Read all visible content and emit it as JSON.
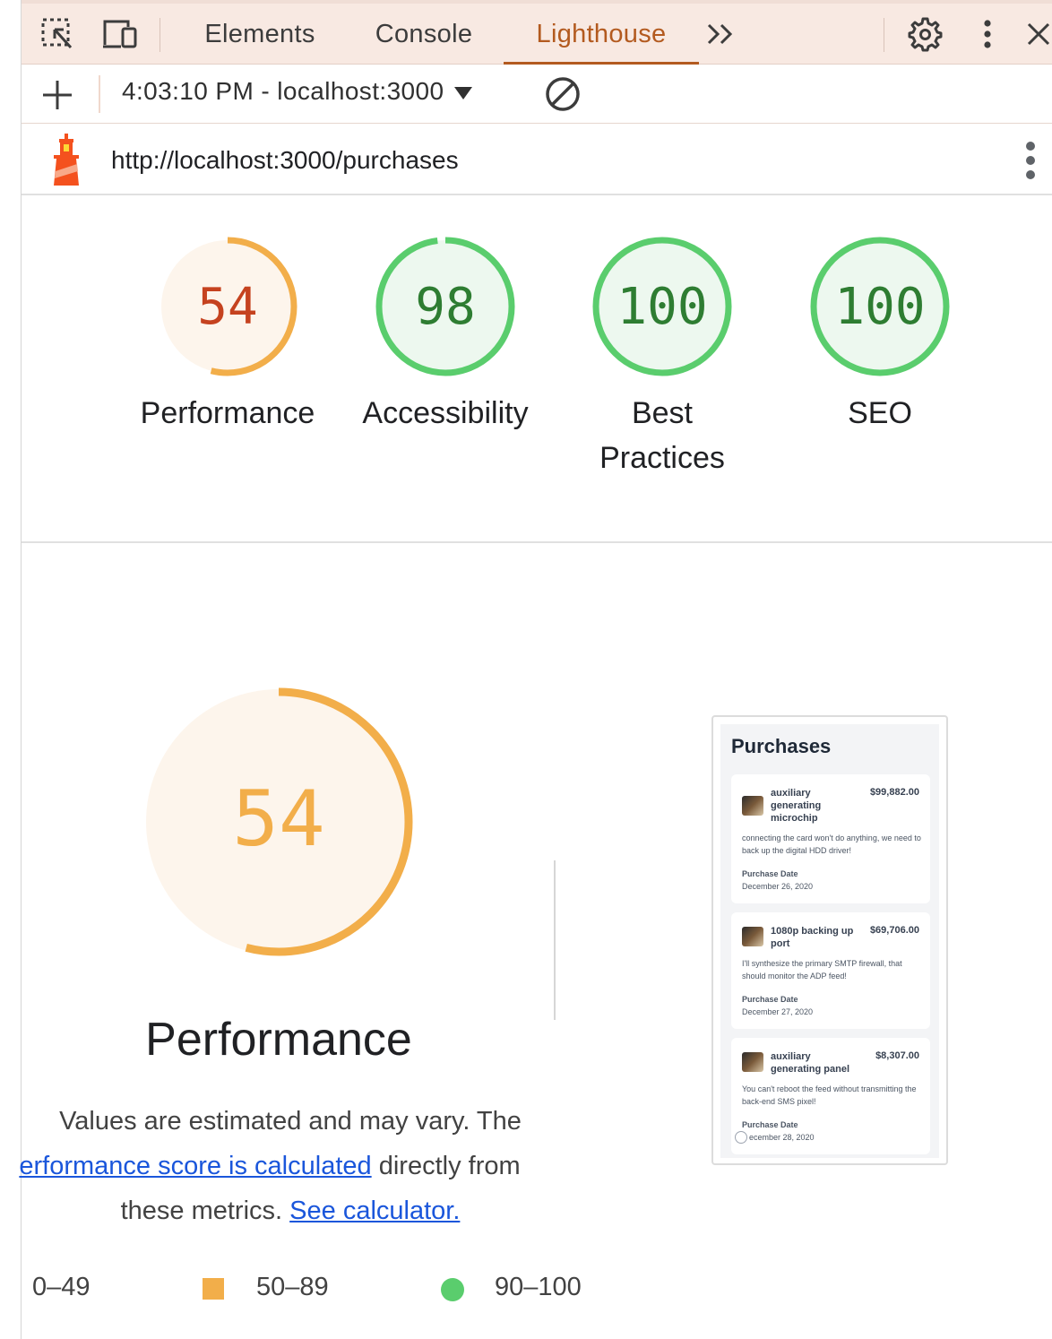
{
  "toolbar": {
    "tabs": [
      {
        "label": "Elements",
        "active": false
      },
      {
        "label": "Console",
        "active": false
      },
      {
        "label": "Lighthouse",
        "active": true
      }
    ],
    "more_tabs_icon": "double-chevron-right-icon",
    "settings_icon": "gear-icon",
    "menu_icon": "kebab-icon",
    "close_icon": "close-icon",
    "inspect_icon": "inspect-element-icon",
    "device_icon": "device-toolbar-icon"
  },
  "runbar": {
    "report_selector": "4:03:10 PM - localhost:3000",
    "new_report_icon": "plus-icon",
    "clear_icon": "block-icon"
  },
  "urlbar": {
    "url": "http://localhost:3000/purchases",
    "logo_icon": "lighthouse-icon",
    "menu_icon": "kebab-icon"
  },
  "scores": [
    {
      "label": "Performance",
      "score": 54
    },
    {
      "label": "Accessibility",
      "score": 98
    },
    {
      "label": "Best Practices",
      "score": 100
    },
    {
      "label": "SEO",
      "score": 100
    }
  ],
  "performance": {
    "score": 54,
    "title": "Performance",
    "desc_prefix": "Values are estimated and may vary. The",
    "desc_link": "erformance score is calculated",
    "desc_middle": "directly from",
    "desc_tail": "these metrics.",
    "calculator_link": "See calculator."
  },
  "legend": [
    {
      "range": "0–49",
      "shape": "triangle",
      "color": "#e53935"
    },
    {
      "range": "50–89",
      "shape": "square",
      "color": "#f2ae4a"
    },
    {
      "range": "90–100",
      "shape": "circle",
      "color": "#5acd6d"
    }
  ],
  "colors": {
    "fail": "#c5421f",
    "average": "#f2ae4a",
    "pass": "#5acd6d",
    "pass_text": "#2e7d32",
    "accent": "#b35a1f"
  },
  "screenshot": {
    "title": "Purchases",
    "cards": [
      {
        "name": "auxiliary generating microchip",
        "price": "$99,882.00",
        "desc": "connecting the card won't do anything, we need to back up the digital HDD driver!",
        "label": "Purchase Date",
        "date": "December 26, 2020"
      },
      {
        "name": "1080p backing up port",
        "price": "$69,706.00",
        "desc": "I'll synthesize the primary SMTP firewall, that should monitor the ADP feed!",
        "label": "Purchase Date",
        "date": "December 27, 2020"
      },
      {
        "name": "auxiliary generating panel",
        "price": "$8,307.00",
        "desc": "You can't reboot the feed without transmitting the back-end SMS pixel!",
        "label": "Purchase Date",
        "date": "ecember 28, 2020"
      }
    ]
  }
}
